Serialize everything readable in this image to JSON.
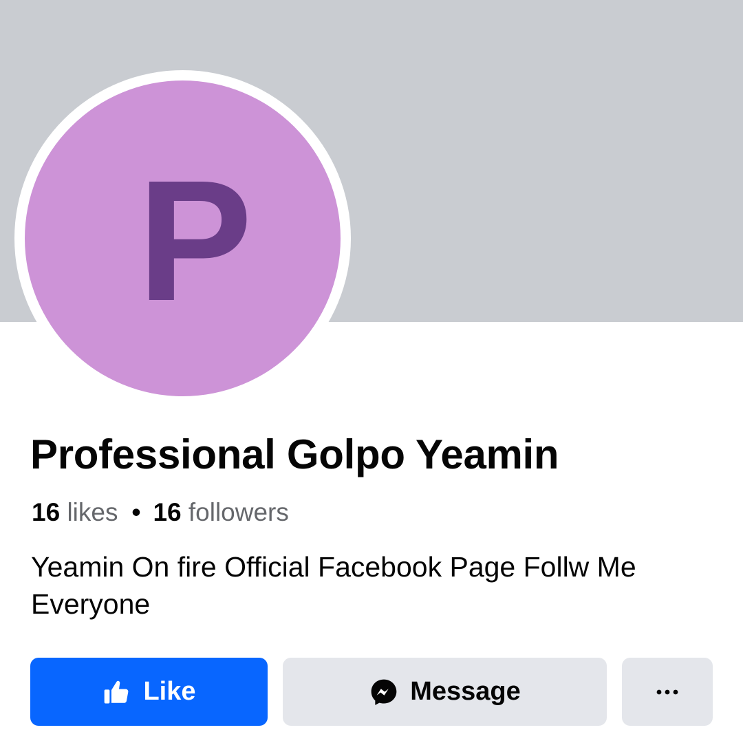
{
  "profile": {
    "avatar_letter": "P",
    "name": "Professional Golpo Yeamin",
    "likes_count": "16",
    "likes_label": "likes",
    "separator": "•",
    "followers_count": "16",
    "followers_label": "followers",
    "bio": "Yeamin On fire Official Facebook Page Follw Me Everyone"
  },
  "actions": {
    "like_label": "Like",
    "like_icon": "thumbs-up-icon",
    "message_label": "Message",
    "message_icon": "messenger-icon",
    "more_icon": "more-options-icon"
  },
  "colors": {
    "cover": "#c9ccd1",
    "avatar_bg": "#cd93d7",
    "avatar_letter": "#6a3d88",
    "primary": "#0866ff",
    "secondary_button": "#e4e6eb",
    "text": "#050505",
    "muted_text": "#65676b"
  }
}
